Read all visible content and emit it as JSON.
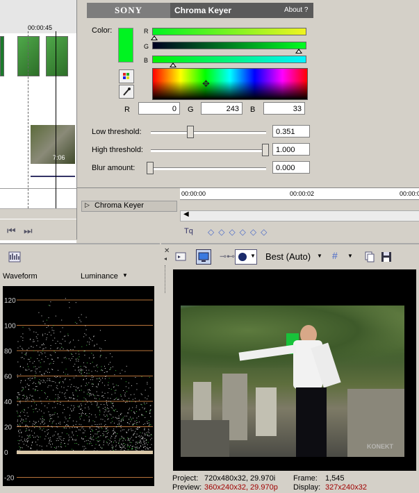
{
  "timeline": {
    "ruler_time": "00:00:45",
    "clip_timecode": "7:06"
  },
  "effect": {
    "brand": "SONY",
    "title": "Chroma Keyer",
    "about": "About  ?",
    "color_label": "Color:",
    "channel_labels": [
      "R",
      "G",
      "B"
    ],
    "rgb": {
      "r_label": "R",
      "g_label": "G",
      "b_label": "B",
      "r": "0",
      "g": "243",
      "b": "33"
    },
    "swatch_color": "#00f321",
    "low_threshold": {
      "label": "Low threshold:",
      "value": "0.351",
      "fraction": 0.351
    },
    "high_threshold": {
      "label": "High threshold:",
      "value": "1.000",
      "fraction": 1.0
    },
    "blur_amount": {
      "label": "Blur amount:",
      "value": "0.000",
      "fraction": 0.0
    },
    "chain_item": "Chroma Keyer",
    "ruler_times": [
      "00:00:00",
      "00:00:02",
      "00:00:0"
    ]
  },
  "scope": {
    "mode": "Waveform",
    "channel": "Luminance",
    "scale_labels": [
      "120",
      "100",
      "80",
      "60",
      "40",
      "20",
      "0",
      "-20"
    ],
    "grid_color": "#b8733a"
  },
  "preview": {
    "quality": "Best (Auto)",
    "project_label": "Project:",
    "project_value": "720x480x32, 29.970i",
    "preview_label": "Preview:",
    "preview_value": "360x240x32, 29.970p",
    "frame_label": "Frame:",
    "frame_value": "1,545",
    "display_label": "Display:",
    "display_value": "327x240x32",
    "watermark": "KONEKT"
  }
}
